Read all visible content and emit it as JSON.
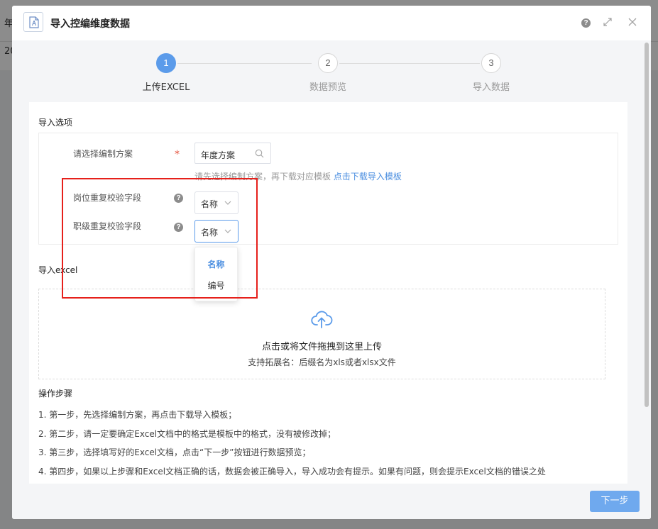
{
  "background": {
    "text_1": "年",
    "text_2": "20"
  },
  "modal": {
    "title": "导入控编维度数据",
    "help_icon": "?",
    "icons": [
      "file-icon",
      "help-icon",
      "expand-icon",
      "close-icon"
    ]
  },
  "steps": [
    {
      "number": "1",
      "label": "上传EXCEL",
      "active": true
    },
    {
      "number": "2",
      "label": "数据预览",
      "active": false
    },
    {
      "number": "3",
      "label": "导入数据",
      "active": false
    }
  ],
  "options": {
    "section_title": "导入选项",
    "plan_label": "请选择编制方案",
    "required_mark": "*",
    "plan_value": "年度方案",
    "hint_text": "请先选择编制方案，再下载对应模板",
    "hint_link": "点击下载导入模板",
    "post_field_label": "岗位重复校验字段",
    "post_field_value": "名称",
    "grade_field_label": "职级重复校验字段",
    "grade_field_value": "名称",
    "q_mark": "?",
    "dropdown_options": [
      "名称",
      "编号"
    ],
    "dropdown_selected": "名称"
  },
  "upload": {
    "section_title": "导入excel",
    "main_text": "点击或将文件拖拽到这里上传",
    "sub_text": "支持拓展名：后缀名为xls或者xlsx文件"
  },
  "instructions": {
    "title": "操作步骤",
    "items": [
      "1. 第一步，先选择编制方案，再点击下载导入模板；",
      "2. 第二步，请一定要确定Excel文档中的格式是模板中的格式，没有被修改掉；",
      "3. 第三步，选择填写好的Excel文档，点击“下一步”按钮进行数据预览；",
      "4. 第四步，如果以上步骤和Excel文档正确的话，数据会被正确导入，导入成功会有提示。如果有问题，则会提示Excel文档的错误之处"
    ]
  },
  "footer": {
    "next_label": "下一步"
  },
  "colors": {
    "accent": "#5b9bea",
    "link": "#4c8fe0",
    "required": "#e4523d",
    "highlight_frame": "#e6201b"
  }
}
